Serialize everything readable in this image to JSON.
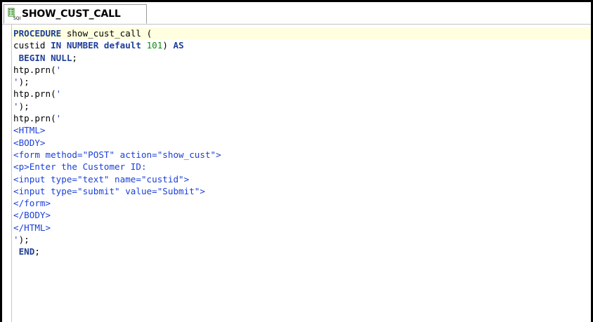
{
  "tab": {
    "title": "SHOW_CUST_CALL",
    "icon": "sql-procedure-icon"
  },
  "code_lines": [
    [
      {
        "t": "PROCEDURE",
        "c": "kw"
      },
      {
        "t": " show_cust_call (",
        "c": "plain"
      }
    ],
    [
      {
        "t": "custid ",
        "c": "plain"
      },
      {
        "t": "IN NUMBER default ",
        "c": "kw"
      },
      {
        "t": "101",
        "c": "num"
      },
      {
        "t": ") ",
        "c": "plain"
      },
      {
        "t": "AS",
        "c": "kw"
      }
    ],
    [
      {
        "t": " BEGIN NULL",
        "c": "kw"
      },
      {
        "t": ";",
        "c": "plain"
      }
    ],
    [
      {
        "t": "htp.prn(",
        "c": "plain"
      },
      {
        "t": "'",
        "c": "str"
      }
    ],
    [
      {
        "t": "'",
        "c": "str"
      },
      {
        "t": ");",
        "c": "plain"
      }
    ],
    [
      {
        "t": "htp.prn(",
        "c": "plain"
      },
      {
        "t": "'",
        "c": "str"
      }
    ],
    [
      {
        "t": "'",
        "c": "str"
      },
      {
        "t": ");",
        "c": "plain"
      }
    ],
    [
      {
        "t": "htp.prn(",
        "c": "plain"
      },
      {
        "t": "'",
        "c": "str"
      }
    ],
    [
      {
        "t": "<HTML>",
        "c": "str"
      }
    ],
    [
      {
        "t": "<BODY>",
        "c": "str"
      }
    ],
    [
      {
        "t": "<form method=\"POST\" action=\"show_cust\">",
        "c": "str"
      }
    ],
    [
      {
        "t": "<p>Enter the Customer ID:",
        "c": "str"
      }
    ],
    [
      {
        "t": "<input type=\"text\" name=\"custid\">",
        "c": "str"
      }
    ],
    [
      {
        "t": "<input type=\"submit\" value=\"Submit\">",
        "c": "str"
      }
    ],
    [
      {
        "t": "</form>",
        "c": "str"
      }
    ],
    [
      {
        "t": "</BODY>",
        "c": "str"
      }
    ],
    [
      {
        "t": "</HTML>",
        "c": "str"
      }
    ],
    [
      {
        "t": "'",
        "c": "str"
      },
      {
        "t": ");",
        "c": "plain"
      }
    ],
    [
      {
        "t": " END",
        "c": "kw"
      },
      {
        "t": ";",
        "c": "plain"
      }
    ]
  ],
  "current_line": 0,
  "colors": {
    "keyword": "#1f3f99",
    "number": "#0d8a0d",
    "string": "#1b3fd8",
    "current_line_bg": "#ffffe0"
  }
}
